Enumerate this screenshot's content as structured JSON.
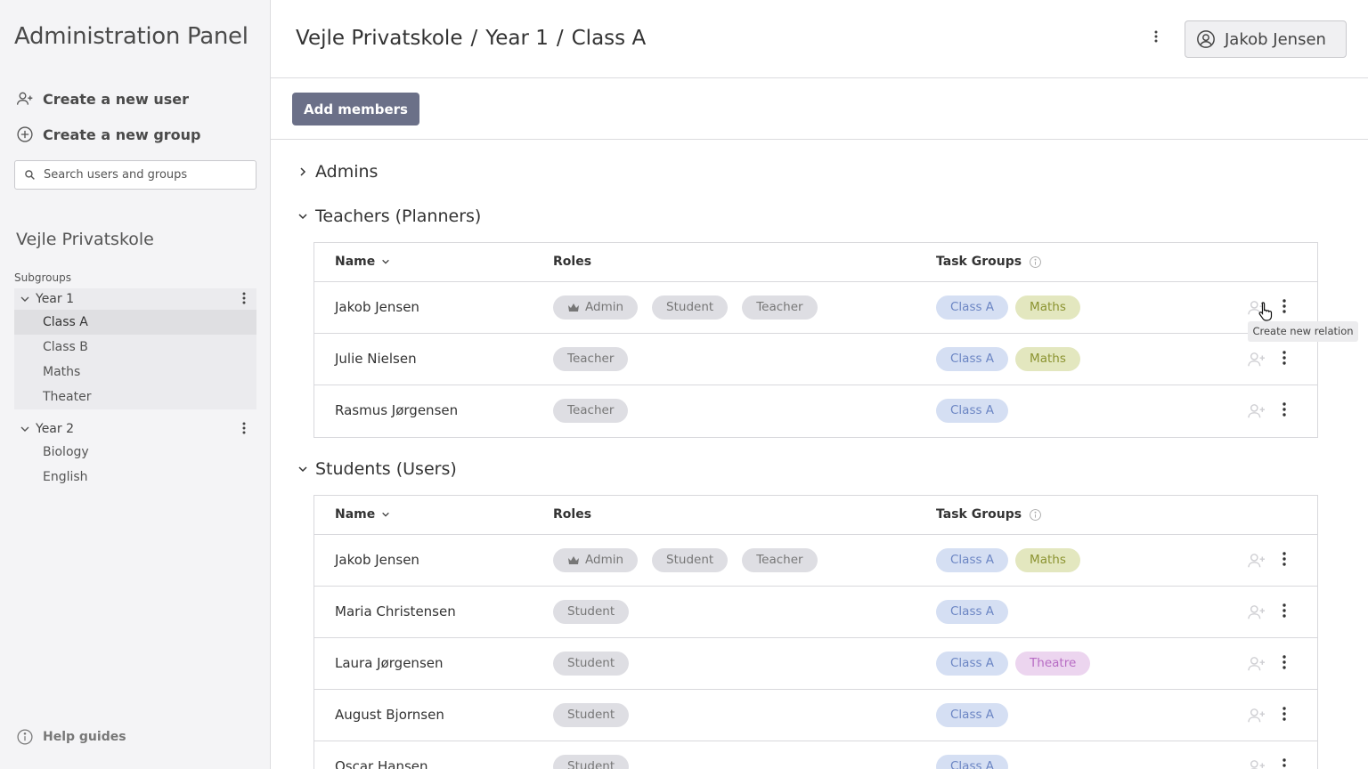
{
  "sidebar": {
    "app_title": "Administration Panel",
    "create_user": "Create a new user",
    "create_group": "Create a new group",
    "search_placeholder": "Search users and groups",
    "org_name": "Vejle Privatskole",
    "subgroups_label": "Subgroups",
    "groups": [
      {
        "label": "Year 1",
        "items": [
          "Class A",
          "Class B",
          "Maths",
          "Theater"
        ]
      },
      {
        "label": "Year 2",
        "items": [
          "Biology",
          "English"
        ]
      }
    ],
    "help": "Help guides"
  },
  "header": {
    "breadcrumb": [
      "Vejle Privatskole",
      "Year 1",
      "Class A"
    ],
    "separator": "/",
    "user": "Jakob Jensen"
  },
  "actions": {
    "add_members": "Add members"
  },
  "sections": {
    "admins": "Admins",
    "teachers": "Teachers (Planners)",
    "students": "Students (Users)"
  },
  "columns": {
    "name": "Name",
    "roles": "Roles",
    "task_groups": "Task Groups"
  },
  "teachers": [
    {
      "name": "Jakob Jensen",
      "roles": [
        "Admin",
        "Student",
        "Teacher"
      ],
      "tasks": [
        "Class A",
        "Maths"
      ]
    },
    {
      "name": "Julie Nielsen",
      "roles": [
        "Teacher"
      ],
      "tasks": [
        "Class A",
        "Maths"
      ]
    },
    {
      "name": "Rasmus Jørgensen",
      "roles": [
        "Teacher"
      ],
      "tasks": [
        "Class A"
      ]
    }
  ],
  "students": [
    {
      "name": "Jakob Jensen",
      "roles": [
        "Admin",
        "Student",
        "Teacher"
      ],
      "tasks": [
        "Class A",
        "Maths"
      ]
    },
    {
      "name": "Maria Christensen",
      "roles": [
        "Student"
      ],
      "tasks": [
        "Class A"
      ]
    },
    {
      "name": "Laura Jørgensen",
      "roles": [
        "Student"
      ],
      "tasks": [
        "Class A",
        "Theatre"
      ]
    },
    {
      "name": "August Bjornsen",
      "roles": [
        "Student"
      ],
      "tasks": [
        "Class A"
      ]
    },
    {
      "name": "Oscar Hansen",
      "roles": [
        "Student"
      ],
      "tasks": [
        "Class A"
      ]
    }
  ],
  "tooltip": "Create new relation",
  "colors": {
    "sidebar_bg": "#f4f4f6",
    "primary_button": "#6b7088",
    "class_chip": "#d5dff3",
    "maths_chip": "#e3e7bf",
    "theatre_chip": "#ecd5ef",
    "role_chip": "#dedee3"
  }
}
